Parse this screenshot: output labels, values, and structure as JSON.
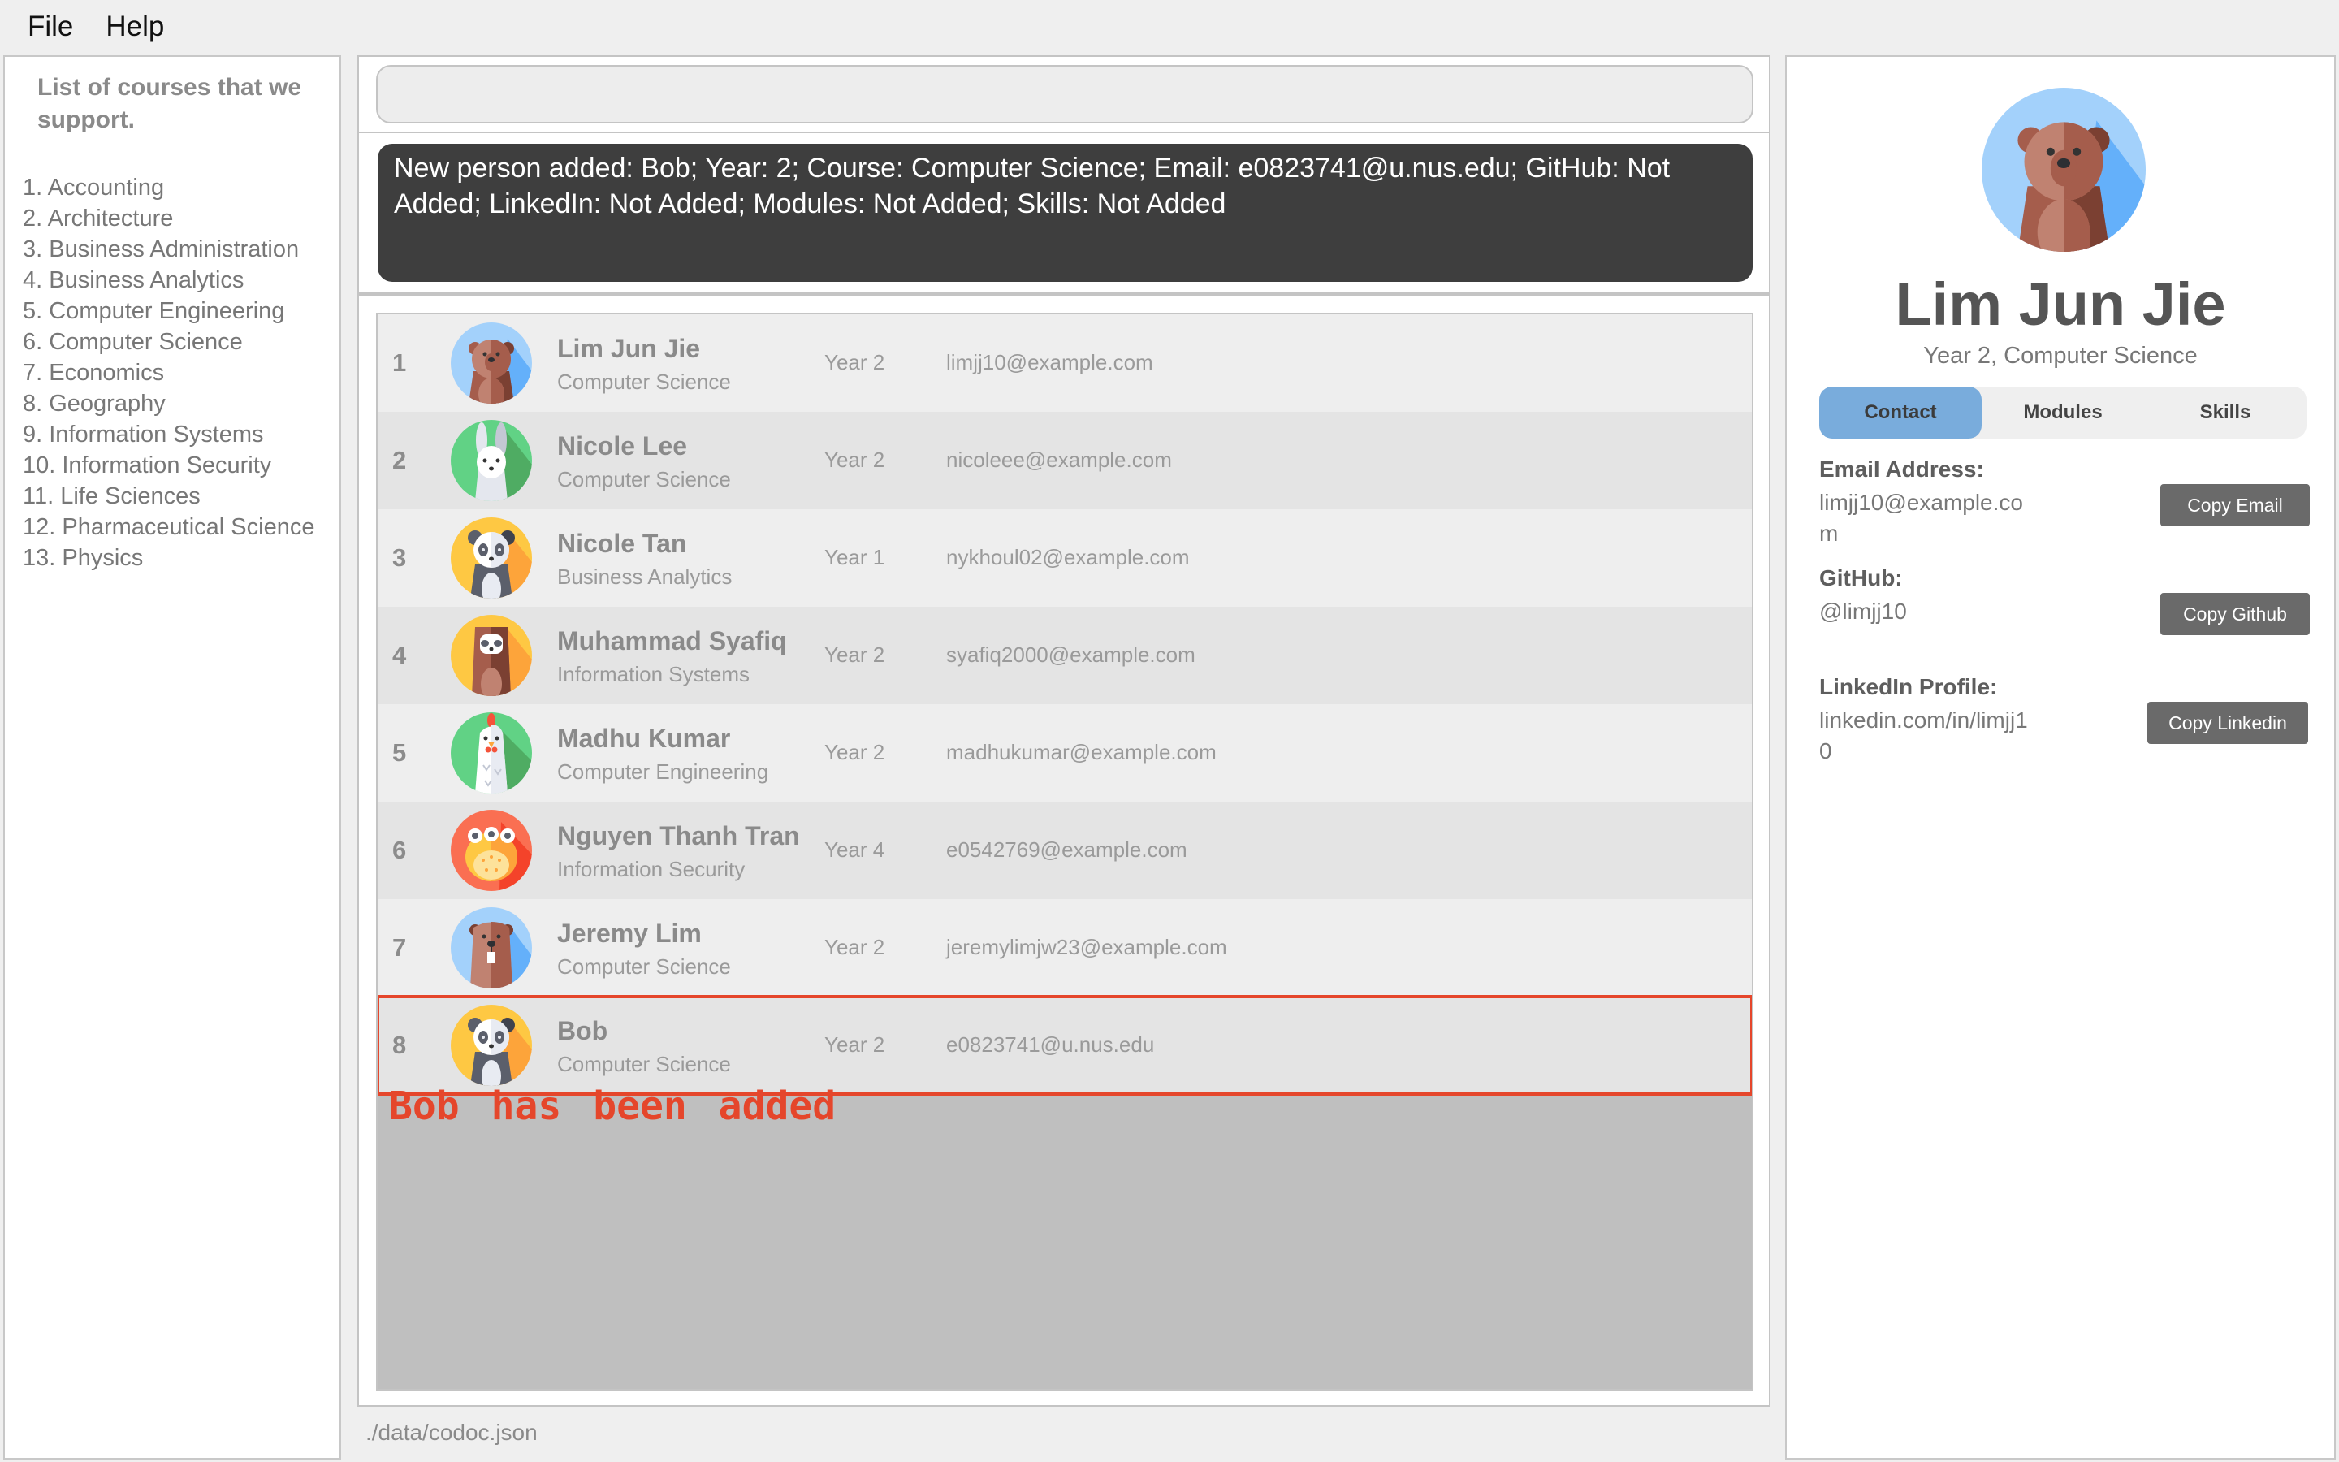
{
  "menu": {
    "file": "File",
    "help": "Help"
  },
  "sidebar": {
    "title": "List of courses that we support.",
    "courses": [
      "1. Accounting",
      "2. Architecture",
      "3. Business Administration",
      "4. Business Analytics",
      "5. Computer Engineering",
      "6. Computer Science",
      "7. Economics",
      "8. Geography",
      "9. Information Systems",
      "10. Information Security",
      "11. Life Sciences",
      "12. Pharmaceutical Science",
      "13. Physics"
    ]
  },
  "command": {
    "value": "",
    "placeholder": ""
  },
  "result": {
    "message": "New person added: Bob; Year: 2; Course: Computer Science; Email: e0823741@u.nus.edu; GitHub: Not Added; LinkedIn: Not Added; Modules: Not Added; Skills: Not Added"
  },
  "persons": [
    {
      "index": "1",
      "name": "Lim Jun Jie",
      "course": "Computer Science",
      "year": "Year 2",
      "email": "limjj10@example.com",
      "avatar": "bear-icon"
    },
    {
      "index": "2",
      "name": "Nicole Lee",
      "course": "Computer Science",
      "year": "Year 2",
      "email": "nicoleee@example.com",
      "avatar": "rabbit-icon"
    },
    {
      "index": "3",
      "name": "Nicole Tan",
      "course": "Business Analytics",
      "year": "Year 1",
      "email": "nykhoul02@example.com",
      "avatar": "panda-icon"
    },
    {
      "index": "4",
      "name": "Muhammad Syafiq",
      "course": "Information Systems",
      "year": "Year 2",
      "email": "syafiq2000@example.com",
      "avatar": "sloth-icon"
    },
    {
      "index": "5",
      "name": "Madhu Kumar",
      "course": "Computer Engineering",
      "year": "Year 2",
      "email": "madhukumar@example.com",
      "avatar": "chicken-icon"
    },
    {
      "index": "6",
      "name": "Nguyen Thanh Tran",
      "course": "Information Security",
      "year": "Year 4",
      "email": "e0542769@example.com",
      "avatar": "pufferfish-icon"
    },
    {
      "index": "7",
      "name": "Jeremy Lim",
      "course": "Computer Science",
      "year": "Year 2",
      "email": "jeremylimjw23@example.com",
      "avatar": "beaver-icon"
    },
    {
      "index": "8",
      "name": "Bob",
      "course": "Computer Science",
      "year": "Year 2",
      "email": "e0823741@u.nus.edu",
      "avatar": "panda-icon",
      "highlighted": true
    }
  ],
  "annotation": {
    "text": "Bob has been added",
    "color": "#e5462b"
  },
  "status": {
    "file_path": "./data/codoc.json"
  },
  "detail": {
    "name": "Lim Jun Jie",
    "subtitle": "Year 2, Computer Science",
    "avatar": "bear-icon",
    "tabs": [
      {
        "label": "Contact",
        "active": true
      },
      {
        "label": "Modules",
        "active": false
      },
      {
        "label": "Skills",
        "active": false
      }
    ],
    "email_label": "Email Address:",
    "email_value": "limjj10@example.com",
    "github_label": "GitHub:",
    "github_value": "@limjj10",
    "linkedin_label": "LinkedIn Profile:",
    "linkedin_value": "linkedin.com/in/limjj10",
    "copy_email": "Copy Email",
    "copy_github": "Copy Github",
    "copy_linkedin": "Copy Linkedin"
  },
  "colors": {
    "accent_tab": "#79acdc",
    "result_bg": "#3e3e3e",
    "highlight": "#e5462b",
    "button": "#6a6a6a"
  }
}
